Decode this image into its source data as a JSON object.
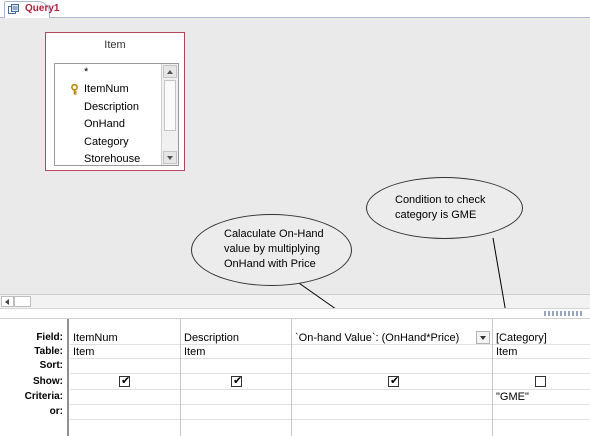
{
  "document_tab": {
    "label": "Query1"
  },
  "table": {
    "name": "Item",
    "fields": [
      "*",
      "ItemNum",
      "Description",
      "OnHand",
      "Category",
      "Storehouse"
    ],
    "primary_key": "ItemNum"
  },
  "callouts": {
    "on_hand": "Calaculate On-Hand value by multiplying OnHand with Price",
    "category": "Condition to check category is GME"
  },
  "grid": {
    "row_labels": {
      "field": "Field:",
      "table": "Table:",
      "sort": "Sort:",
      "show": "Show:",
      "criteria": "Criteria:",
      "or": "or:"
    },
    "columns": [
      {
        "field": "ItemNum",
        "table": "Item",
        "sort": "",
        "show": true,
        "criteria": ""
      },
      {
        "field": "Description",
        "table": "Item",
        "sort": "",
        "show": true,
        "criteria": ""
      },
      {
        "field": "`On-hand Value`: (OnHand*Price)",
        "table": "",
        "sort": "",
        "show": true,
        "criteria": ""
      },
      {
        "field": "[Category]",
        "table": "Item",
        "sort": "",
        "show": false,
        "criteria": "\"GME\""
      }
    ]
  },
  "icons": {
    "tab": "query-icon",
    "key": "primary-key-icon",
    "check": "✔"
  }
}
